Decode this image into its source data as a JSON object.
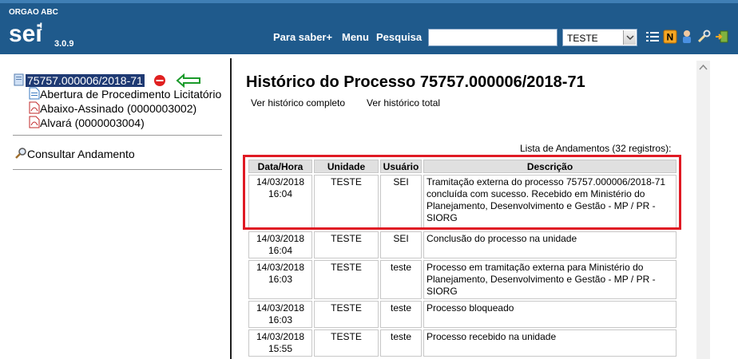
{
  "header": {
    "org": "ORGAO ABC",
    "version": "3.0.9",
    "nav": [
      "Para saber+",
      "Menu",
      "Pesquisa"
    ],
    "search_value": "",
    "unit": "TESTE"
  },
  "tree": {
    "process_number": "75757.000006/2018-71",
    "documents": [
      "Abertura de Procedimento Licitatório",
      "Abaixo-Assinado (0000003002)",
      "Alvará (0000003004)"
    ],
    "consult": "Consultar Andamento"
  },
  "main": {
    "title": "Histórico do Processo 75757.000006/2018-71",
    "link_full": "Ver histórico completo",
    "link_total": "Ver histórico total",
    "caption": "Lista de Andamentos (32 registros):",
    "columns": [
      "Data/Hora",
      "Unidade",
      "Usuário",
      "Descrição"
    ],
    "rows": [
      {
        "date": "14/03/2018",
        "time": "16:04",
        "unit": "TESTE",
        "user": "SEI",
        "desc": "Tramitação externa do processo 75757.000006/2018-71 concluída com sucesso. Recebido em Ministério do Planejamento, Desenvolvimento e Gestão - MP / PR - SIORG"
      },
      {
        "date": "14/03/2018",
        "time": "16:04",
        "unit": "TESTE",
        "user": "SEI",
        "desc": "Conclusão do processo na unidade"
      },
      {
        "date": "14/03/2018",
        "time": "16:03",
        "unit": "TESTE",
        "user": "teste",
        "desc": "Processo em tramitação externa para Ministério do Planejamento, Desenvolvimento e Gestão - MP / PR - SIORG"
      },
      {
        "date": "14/03/2018",
        "time": "16:03",
        "unit": "TESTE",
        "user": "teste",
        "desc": "Processo bloqueado"
      },
      {
        "date": "14/03/2018",
        "time": "15:55",
        "unit": "TESTE",
        "user": "teste",
        "desc": "Processo recebido na unidade"
      }
    ]
  },
  "colors": {
    "header_bg": "#1f5a8c",
    "highlight": "#e01a24",
    "selection": "#1f3a73"
  }
}
